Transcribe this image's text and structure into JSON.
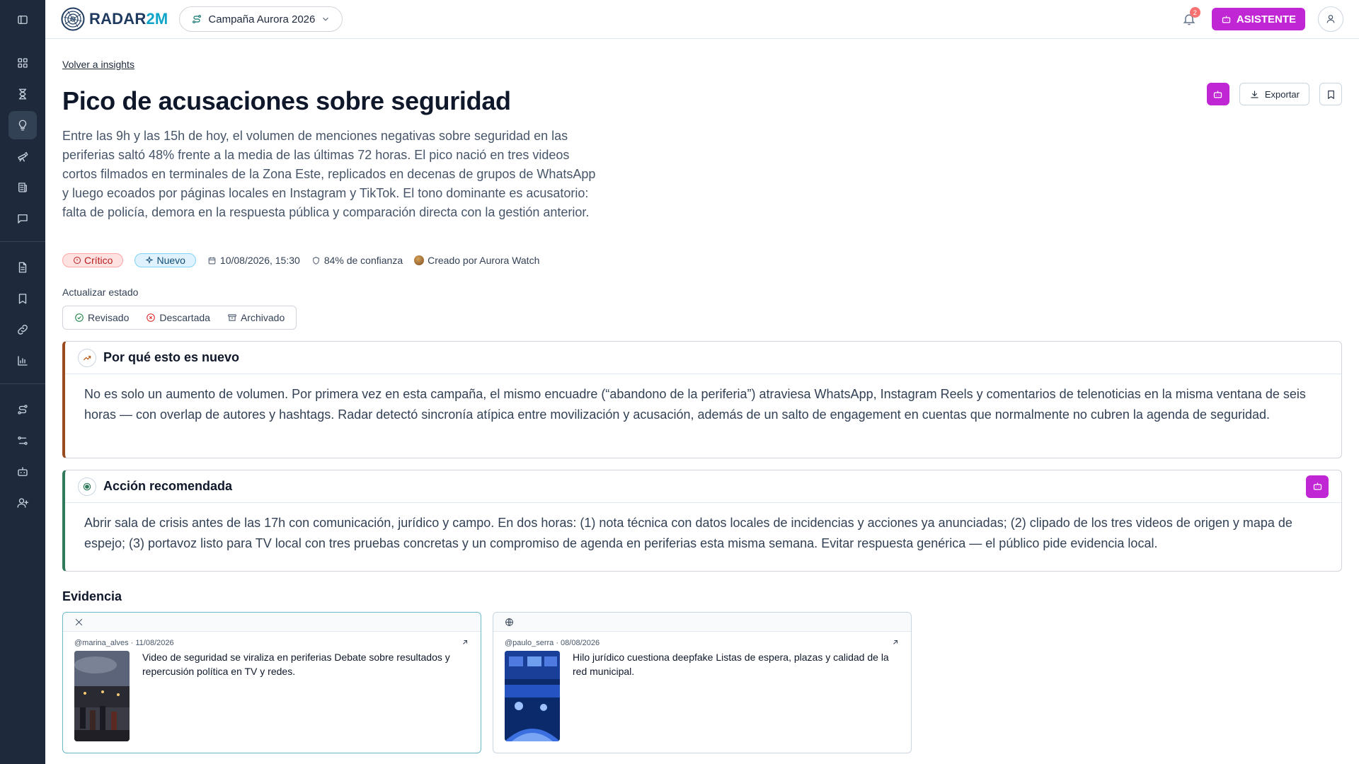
{
  "brand": {
    "name_main": "RADAR",
    "name_accent": "2M"
  },
  "header": {
    "campaign": "Campaña Aurora 2026",
    "notifications_count": "2",
    "assistant_label": "ASISTENTE"
  },
  "nav": {
    "back_link": "Volver a insights"
  },
  "insight": {
    "title": "Pico de acusaciones sobre seguridad",
    "description": "Entre las 9h y las 15h de hoy, el volumen de menciones negativas sobre seguridad en las periferias saltó 48% frente a la media de las últimas 72 horas. El pico nació en tres videos cortos filmados en terminales de la Zona Este, replicados en decenas de grupos de WhatsApp y luego ecoados por páginas locales en Instagram y TikTok. El tono dominante es acusatorio: falta de policía, demora en la respuesta pública y comparación directa con la gestión anterior.",
    "export_label": "Exportar",
    "severity": "Crítico",
    "status_chip": "Nuevo",
    "datetime": "10/08/2026, 15:30",
    "confidence": "84% de confianza",
    "creator": "Creado por Aurora Watch"
  },
  "state": {
    "label": "Actualizar estado",
    "options": [
      "Revisado",
      "Descartada",
      "Archivado"
    ]
  },
  "why_new": {
    "title": "Por qué esto es nuevo",
    "body": "No es solo un aumento de volumen. Por primera vez en esta campaña, el mismo encuadre (“abandono de la periferia”) atraviesa WhatsApp, Instagram Reels y comentarios de telenoticias en la misma ventana de seis horas — con overlap de autores y hashtags. Radar detectó sincronía atípica entre movilización y acusación, además de un salto de engagement en cuentas que normalmente no cubren la agenda de seguridad."
  },
  "recommended": {
    "title": "Acción recomendada",
    "body": "Abrir sala de crisis antes de las 17h con comunicación, jurídico y campo. En dos horas: (1) nota técnica con datos locales de incidencias y acciones ya anunciadas; (2) clipado de los tres videos de origen y mapa de espejo; (3) portavoz listo para TV local con tres pruebas concretas y un compromiso de agenda en periferias esta misma semana. Evitar respuesta genérica — el público pide evidencia local."
  },
  "evidence": {
    "title": "Evidencia",
    "items": [
      {
        "platform_icon": "x-icon",
        "meta": "@marina_alves · 11/08/2026",
        "text": "Video de seguridad se viraliza en periferias Debate sobre resultados y repercusión política en TV y redes."
      },
      {
        "platform_icon": "globe-icon",
        "meta": "@paulo_serra · 08/08/2026",
        "text": "Hilo jurídico cuestiona deepfake Listas de espera, plazas y calidad de la red municipal."
      }
    ]
  },
  "colors": {
    "sidebar": "#1e293b",
    "accent": "#c026d3",
    "why_border": "#9a4a1f",
    "action_border": "#2f7a5a",
    "critical": "#b91c1c"
  }
}
